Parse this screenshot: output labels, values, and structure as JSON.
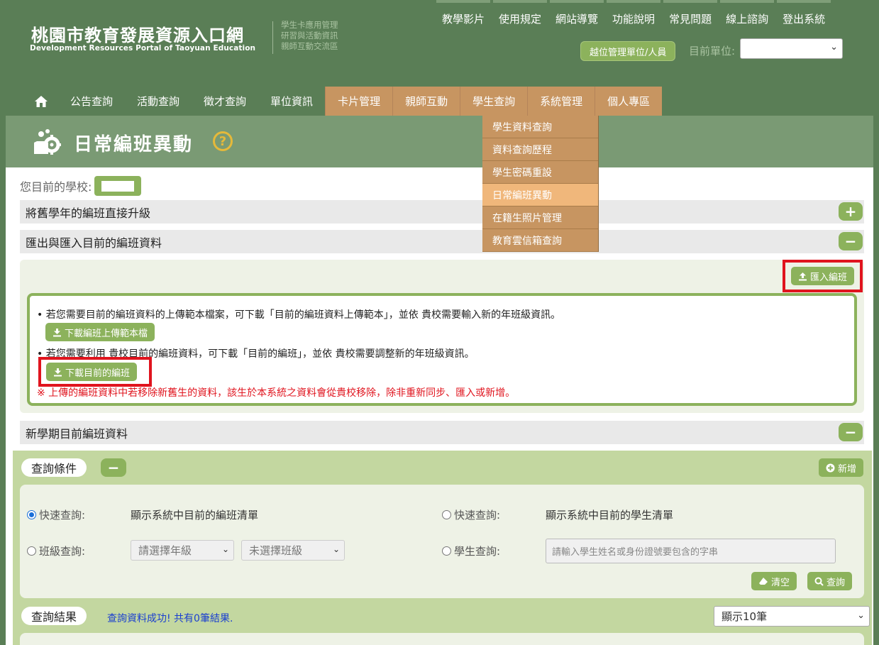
{
  "header": {
    "title_zh": "桃園市教育發展資源入口網",
    "title_en": "Development Resources Portal of Taoyuan Education",
    "subtitle_lines": [
      "學生卡應用管理",
      "研習與活動資訊",
      "親師互動交流區"
    ],
    "top_links": [
      "教學影片",
      "使用規定",
      "網站導覽",
      "功能說明",
      "常見問題",
      "線上諮詢",
      "登出系統"
    ],
    "mgmt_button": "越位管理單位/人員",
    "unit_label": "目前單位:",
    "unit_value": ""
  },
  "nav": {
    "items": [
      "公告查詢",
      "活動查詢",
      "徵才查詢",
      "單位資訊",
      "卡片管理",
      "親師互動",
      "學生查詢",
      "系統管理",
      "個人專區"
    ],
    "dropdown": [
      "學生資料查詢",
      "資料查詢歷程",
      "學生密碼重設",
      "日常編班異動",
      "在籍生照片管理",
      "教育雲信箱查詢"
    ]
  },
  "page": {
    "title": "日常編班異動",
    "help_symbol": "?",
    "school_label": "您目前的學校:"
  },
  "sections": {
    "promote": "將舊學年的編班直接升級",
    "export_import": "匯出與匯入目前的編班資料",
    "new_term": "新學期目前編班資料",
    "plus": "+",
    "minus": "−"
  },
  "io_panel": {
    "import_button": "匯入編班",
    "line1": "• 若您需要目前的編班資料的上傳範本檔案，可下載「目前的編班資料上傳範本」，並依 貴校需要輸入新的年班級資訊。",
    "download_template": "下載編班上傳範本檔",
    "line2": "• 若您需要利用 貴校目前的編班資料，可下載「目前的編班」，並依 貴校需要調整新的年班級資訊。",
    "download_current": "下載目前的編班",
    "warning": "※ 上傳的編班資料中若移除新舊生的資料，該生於本系統之資料會從貴校移除，除非重新同步、匯入或新增。"
  },
  "query": {
    "conditions_label": "查詢條件",
    "new_button": "新增",
    "quick1_label": "快速查詢:",
    "quick1_desc": "顯示系統中目前的編班清單",
    "quick2_label": "快速查詢:",
    "quick2_desc": "顯示系統中目前的學生清單",
    "class_label": "班級查詢:",
    "grade_select": "請選擇年級",
    "class_select": "未選擇班級",
    "student_label": "學生查詢:",
    "student_placeholder": "請輸入學生姓名或身份證號要包含的字串",
    "clear_button": "清空",
    "search_button": "查詢"
  },
  "result": {
    "label": "查詢結果",
    "message": "查詢資料成功! 共有0筆結果.",
    "page_size": "顯示10筆"
  }
}
